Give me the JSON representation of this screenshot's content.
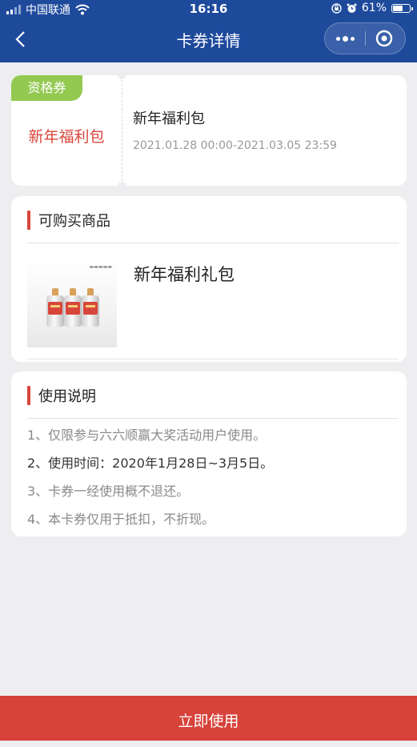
{
  "status_bar": {
    "carrier": "中国联通",
    "time": "16:16",
    "battery_text": "61%",
    "battery_level": 0.61,
    "icons": [
      "signal-icon",
      "wifi-icon",
      "orientation-lock-icon",
      "alarm-icon",
      "battery-icon"
    ]
  },
  "nav": {
    "title": "卡券详情",
    "icons": [
      "back-icon",
      "more-icon",
      "close-target-icon"
    ]
  },
  "coupon": {
    "tag": "资格券",
    "name": "新年福利包",
    "title": "新年福利包",
    "period": "2021.01.28 00:00-2021.03.05 23:59"
  },
  "products": {
    "section_title": "可购买商品",
    "items": [
      {
        "name": "新年福利礼包"
      }
    ]
  },
  "usage": {
    "section_title": "使用说明",
    "lines": [
      "1、仅限参与六六顺赢大奖活动用户使用。",
      "2、使用时间：2020年1月28日~3月5日。",
      "3、卡券一经使用概不退还。",
      "4、本卡券仅用于抵扣，不折现。"
    ]
  },
  "action": {
    "use_label": "立即使用"
  },
  "colors": {
    "nav_bg": "#1e4a9c",
    "accent_red": "#d8463b",
    "tag_green": "#93c950",
    "button_red": "#d7423a",
    "page_bg": "#eeeef0"
  }
}
